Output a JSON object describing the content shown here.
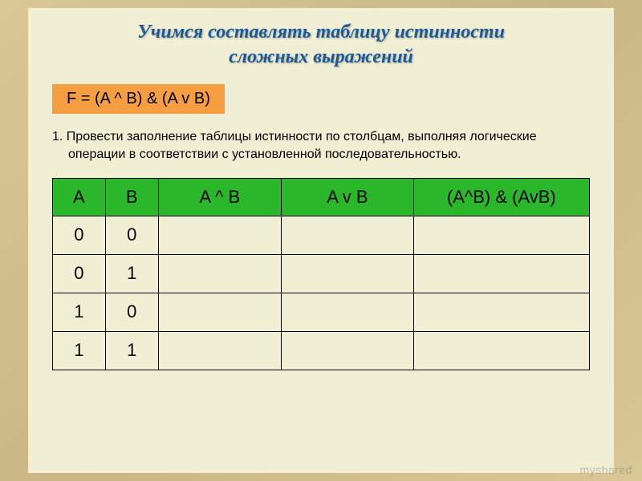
{
  "title_line1": "Учимся составлять таблицу истинности",
  "title_line2": "сложных выражений",
  "formula": "F = (A ^ B) & (A v B)",
  "instruction_number": "1.",
  "instruction_text": "Провести заполнение таблицы истинности по столбцам, выполняя логические операции в соответствии с установленной последовательностью.",
  "table": {
    "headers": [
      "A",
      "B",
      "A ^ B",
      "A v B",
      "(A^B) & (AvB)"
    ],
    "rows": [
      [
        "0",
        "0",
        "",
        "",
        ""
      ],
      [
        "0",
        "1",
        "",
        "",
        ""
      ],
      [
        "1",
        "0",
        "",
        "",
        ""
      ],
      [
        "1",
        "1",
        "",
        "",
        ""
      ]
    ]
  },
  "watermark": "myshared"
}
